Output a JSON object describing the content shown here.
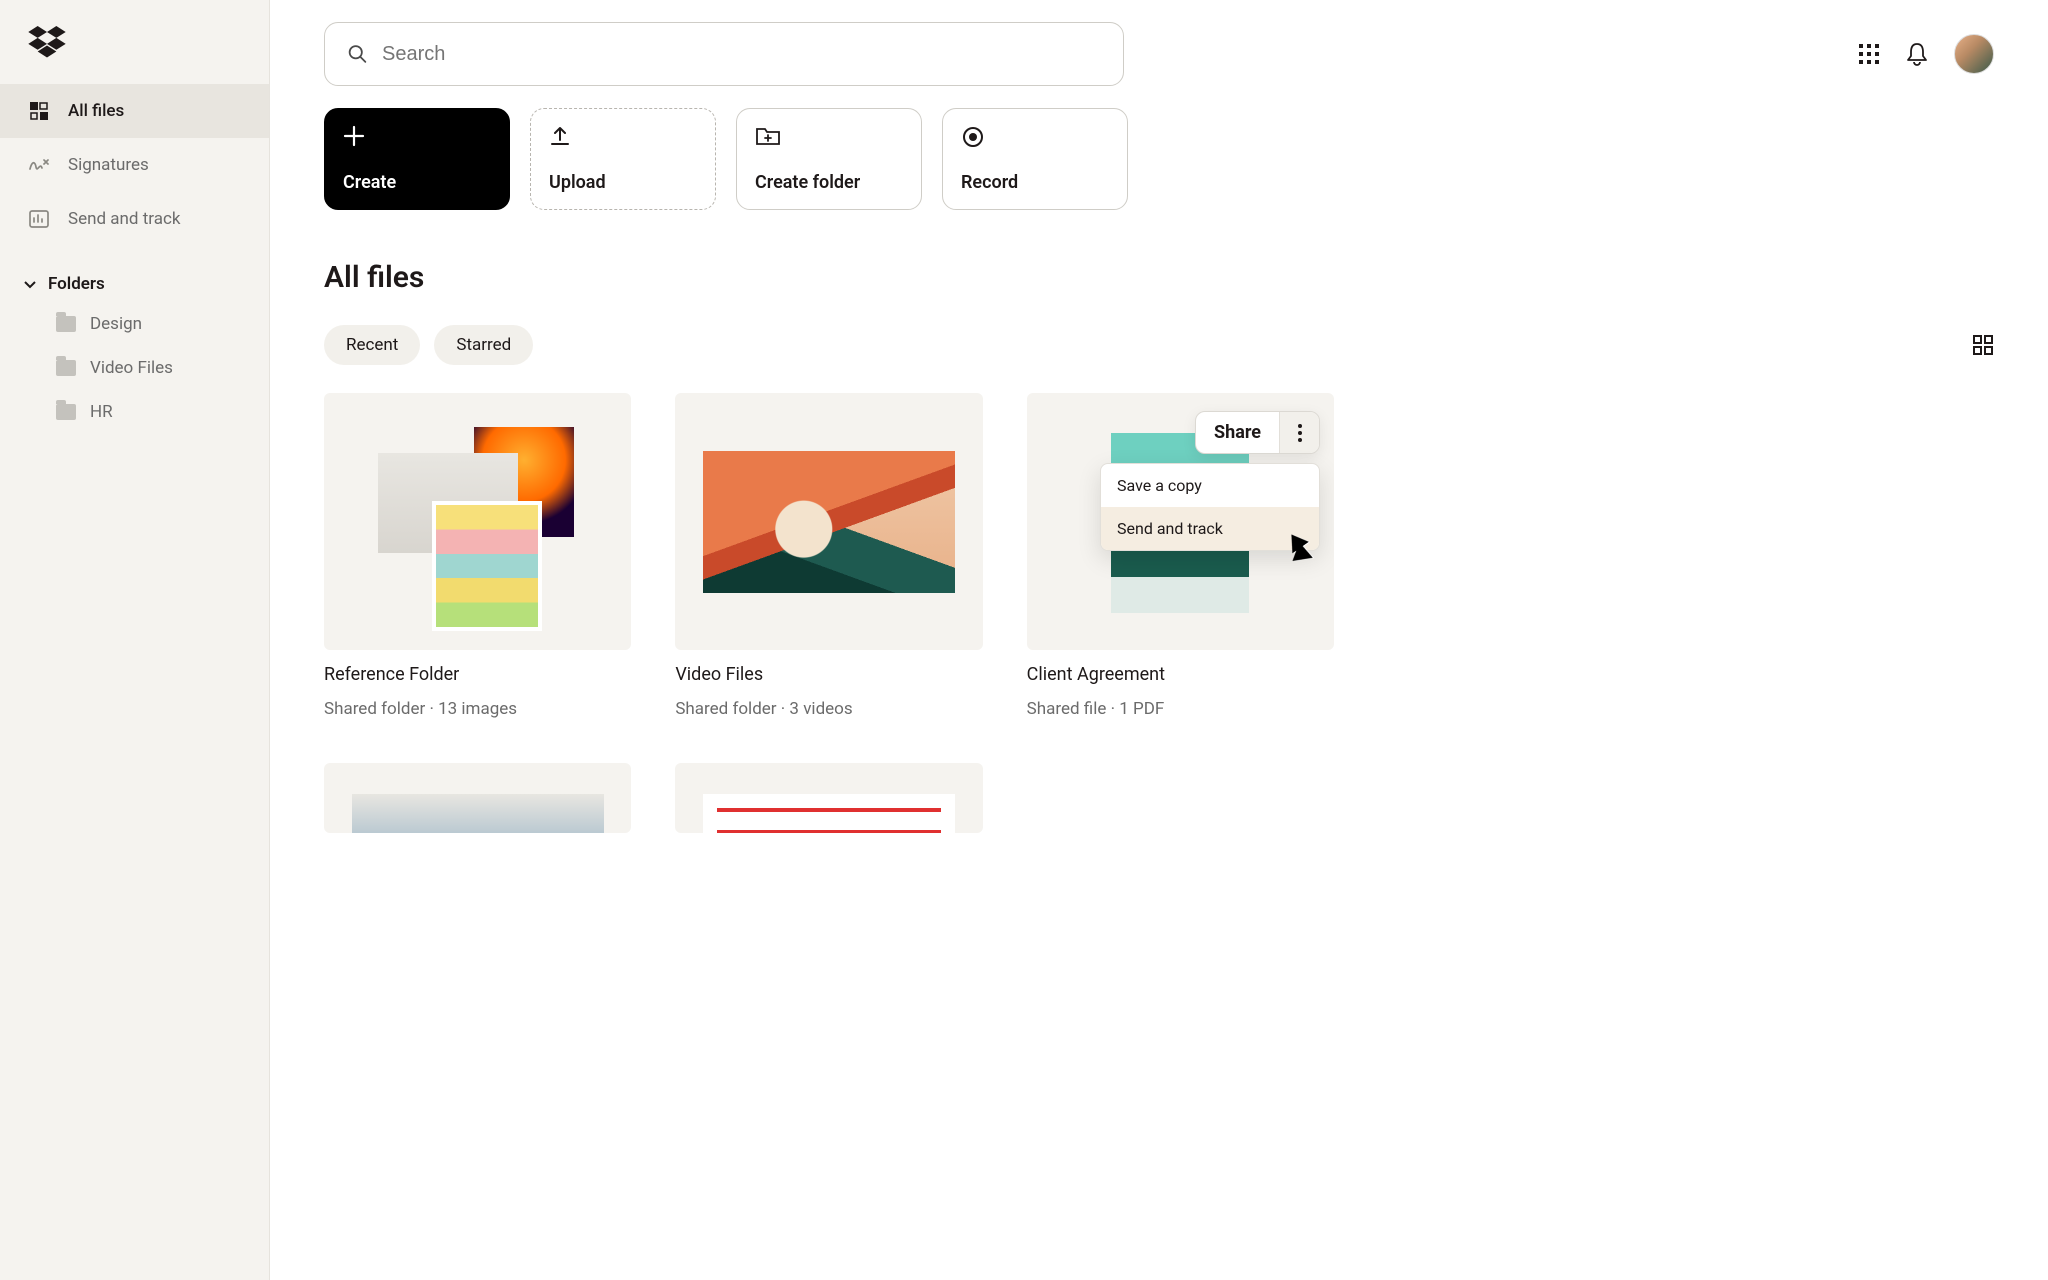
{
  "search": {
    "placeholder": "Search"
  },
  "sidebar": {
    "items": [
      {
        "label": "All files"
      },
      {
        "label": "Signatures"
      },
      {
        "label": "Send and track"
      }
    ],
    "folders_heading": "Folders",
    "folders": [
      {
        "label": "Design"
      },
      {
        "label": "Video Files"
      },
      {
        "label": "HR"
      }
    ]
  },
  "actions": {
    "create": "Create",
    "upload": "Upload",
    "create_folder": "Create folder",
    "record": "Record"
  },
  "page_title": "All files",
  "filters": {
    "recent": "Recent",
    "starred": "Starred"
  },
  "cards": [
    {
      "title": "Reference Folder",
      "sub": "Shared folder · 13 images"
    },
    {
      "title": "Video Files",
      "sub": "Shared folder · 3 videos"
    },
    {
      "title": "Client Agreement",
      "sub": "Shared file · 1 PDF"
    }
  ],
  "card3": {
    "share_label": "Share",
    "doc_label": "Client Agreement",
    "menu": {
      "save": "Save a copy",
      "send": "Send and track"
    }
  }
}
